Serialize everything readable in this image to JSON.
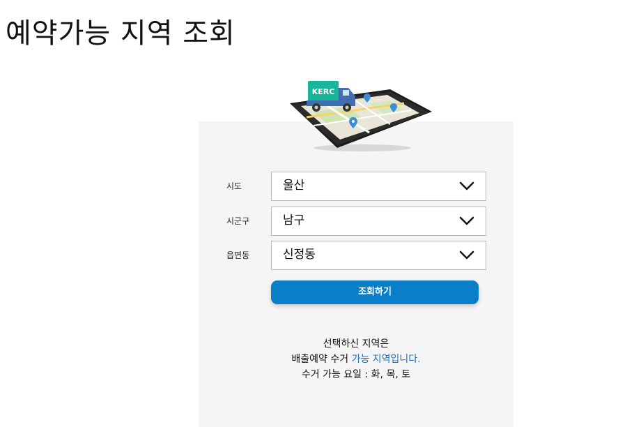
{
  "page": {
    "title": "예약가능 지역 조회"
  },
  "illustration": {
    "truck_label": "KERC"
  },
  "form": {
    "sido": {
      "label": "시도",
      "value": "울산",
      "icon": "chevron-down-icon"
    },
    "sigungu": {
      "label": "시군구",
      "value": "남구",
      "icon": "chevron-down-icon"
    },
    "eupmyeondong": {
      "label": "읍면동",
      "value": "신정동",
      "icon": "chevron-down-icon"
    },
    "search_button": "조회하기"
  },
  "result": {
    "line1": "선택하신 지역은",
    "line2_prefix": "배출예약 수거 ",
    "line2_highlight": "가능 지역입니다.",
    "line3": "수거 가능 요일 : 화, 목, 토"
  },
  "colors": {
    "accent": "#0a7fc8",
    "highlight_text": "#1f6fb8",
    "panel_bg": "#f5f5f5",
    "truck_badge": "#18b59a"
  }
}
